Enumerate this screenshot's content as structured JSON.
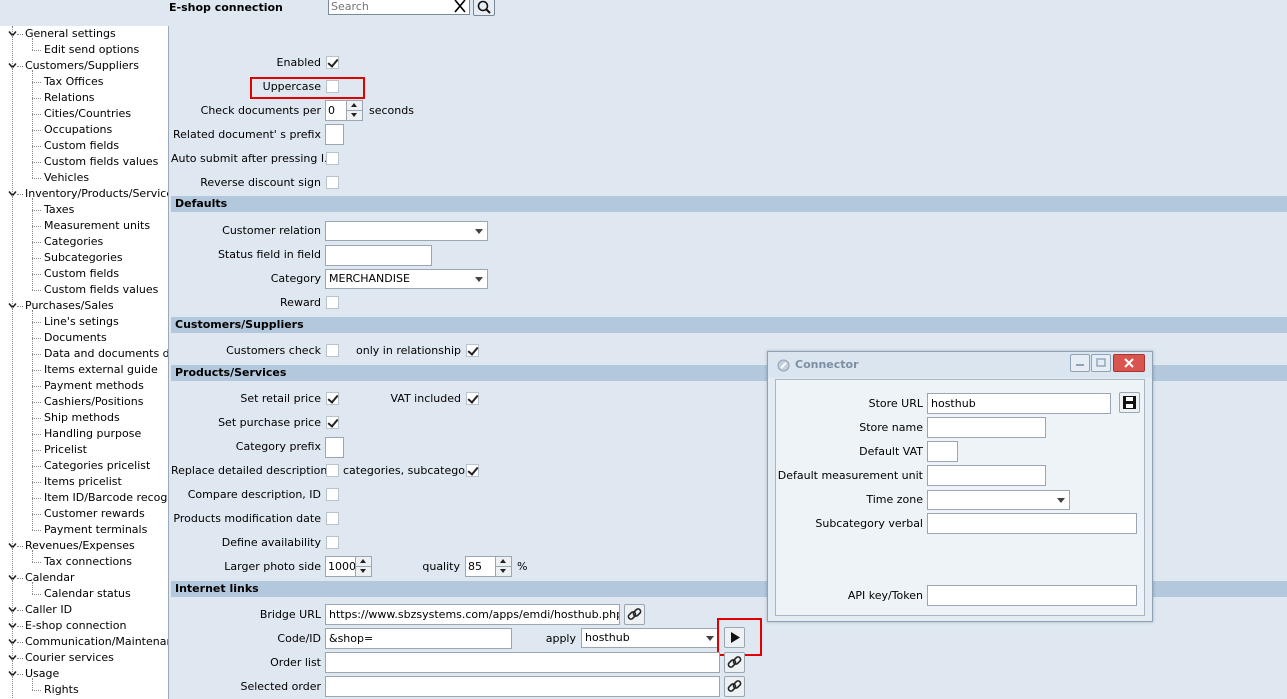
{
  "app": {
    "title": "E-shop connection",
    "search_placeholder": "Search"
  },
  "sidebar": {
    "items": [
      {
        "label": "General settings",
        "level": 0
      },
      {
        "label": "Edit send options",
        "level": 1
      },
      {
        "label": "Customers/Suppliers",
        "level": 0
      },
      {
        "label": "Tax Offices",
        "level": 1
      },
      {
        "label": "Relations",
        "level": 1
      },
      {
        "label": "Cities/Countries",
        "level": 1
      },
      {
        "label": "Occupations",
        "level": 1
      },
      {
        "label": "Custom fields",
        "level": 1
      },
      {
        "label": "Custom fields values",
        "level": 1
      },
      {
        "label": "Vehicles",
        "level": 1
      },
      {
        "label": "Inventory/Products/Services",
        "level": 0
      },
      {
        "label": "Taxes",
        "level": 1
      },
      {
        "label": "Measurement units",
        "level": 1
      },
      {
        "label": "Categories",
        "level": 1
      },
      {
        "label": "Subcategories",
        "level": 1
      },
      {
        "label": "Custom fields",
        "level": 1
      },
      {
        "label": "Custom fields values",
        "level": 1
      },
      {
        "label": "Purchases/Sales",
        "level": 0
      },
      {
        "label": "Line's setings",
        "level": 1
      },
      {
        "label": "Documents",
        "level": 1
      },
      {
        "label": "Data and documents desi",
        "level": 1
      },
      {
        "label": "Items external guide",
        "level": 1
      },
      {
        "label": "Payment methods",
        "level": 1
      },
      {
        "label": "Cashiers/Positions",
        "level": 1
      },
      {
        "label": "Ship methods",
        "level": 1
      },
      {
        "label": "Handling purpose",
        "level": 1
      },
      {
        "label": "Pricelist",
        "level": 1
      },
      {
        "label": "Categories pricelist",
        "level": 1
      },
      {
        "label": "Items pricelist",
        "level": 1
      },
      {
        "label": "Item ID/Barcode recognize",
        "level": 1
      },
      {
        "label": "Customer rewards",
        "level": 1
      },
      {
        "label": "Payment terminals",
        "level": 1
      },
      {
        "label": "Revenues/Expenses",
        "level": 0
      },
      {
        "label": "Tax connections",
        "level": 1
      },
      {
        "label": "Calendar",
        "level": 0
      },
      {
        "label": "Calendar status",
        "level": 1
      },
      {
        "label": "Caller ID",
        "level": 0
      },
      {
        "label": "E-shop connection",
        "level": 0
      },
      {
        "label": "Communication/Maintenance",
        "level": 0
      },
      {
        "label": "Courier services",
        "level": 0
      },
      {
        "label": "Usage",
        "level": 0
      },
      {
        "label": "Rights",
        "level": 1
      }
    ]
  },
  "general": {
    "enabled_label": "Enabled",
    "enabled": true,
    "uppercase_label": "Uppercase",
    "uppercase": false,
    "check_docs_label": "Check documents per",
    "check_docs_value": "0",
    "seconds_label": "seconds",
    "related_prefix_label": "Related document' s prefix",
    "auto_submit_label": "Auto submit after pressing I...",
    "reverse_discount_label": "Reverse discount sign"
  },
  "defaults": {
    "header": "Defaults",
    "customer_relation_label": "Customer relation",
    "customer_relation_value": "",
    "status_field_label": "Status field in field",
    "status_field_value": "",
    "category_label": "Category",
    "category_value": "MERCHANDISE",
    "reward_label": "Reward"
  },
  "customers": {
    "header": "Customers/Suppliers",
    "check_label": "Customers check",
    "only_rel_label": "only in relationship"
  },
  "products": {
    "header": "Products/Services",
    "retail_label": "Set retail price",
    "vat_label": "VAT included",
    "purchase_label": "Set purchase price",
    "cat_prefix_label": "Category prefix",
    "replace_desc_label": "Replace detailed description",
    "replace_desc_sub_label": "categories, subcatego...",
    "compare_label": "Compare description, ID",
    "mod_date_label": "Products modification date",
    "define_avail_label": "Define availability",
    "photo_side_label": "Larger photo side",
    "photo_side_value": "1000",
    "quality_label": "quality",
    "quality_value": "85",
    "percent_label": "%"
  },
  "internet": {
    "header": "Internet links",
    "bridge_label": "Bridge URL",
    "bridge_value": "https://www.sbzsystems.com/apps/emdi/hosthub.php",
    "code_label": "Code/ID",
    "code_value": "&shop=",
    "apply_label": "apply",
    "apply_value": "hosthub",
    "order_list_label": "Order list",
    "order_list_value": "",
    "selected_order_label": "Selected order",
    "selected_order_value": ""
  },
  "connector": {
    "title": "Connector",
    "store_url_label": "Store URL",
    "store_url_value": "hosthub",
    "store_name_label": "Store name",
    "default_vat_label": "Default VAT",
    "default_unit_label": "Default measurement unit",
    "time_zone_label": "Time zone",
    "subcat_verbal_label": "Subcategory verbal",
    "api_key_label": "API key/Token"
  },
  "colors": {
    "background": "#dfe8f1",
    "section_header": "#b3c8dc",
    "highlight": "#e00000"
  }
}
